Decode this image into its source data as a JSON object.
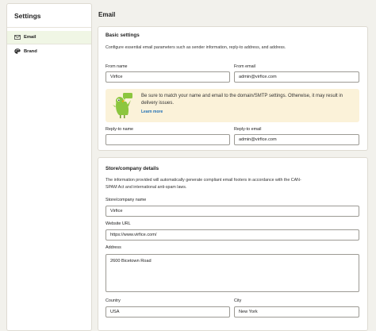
{
  "sidebar": {
    "title": "Settings",
    "items": [
      {
        "label": "Email",
        "icon": "mail-icon",
        "active": true
      },
      {
        "label": "Brand",
        "icon": "palette-icon",
        "active": false
      }
    ]
  },
  "page_title": "Email",
  "basic": {
    "title": "Basic settings",
    "description": "Configure essential email parameters such as sender information, reply-to address, and address.",
    "from_name_label": "From name",
    "from_name_value": "Virfice",
    "from_email_label": "From email",
    "from_email_value": "admin@virfice.com",
    "banner_text": "Be sure to match your name and email to the domain/SMTP settings. Otherwise, it may result in delivery issues.",
    "banner_link": "Learn more",
    "reply_to_name_label": "Reply-to name",
    "reply_to_name_value": "",
    "reply_to_email_label": "Reply-to email",
    "reply_to_email_value": "admin@virfice.com"
  },
  "company": {
    "title": "Store/company details",
    "description": "The information provided will automatically generate compliant email footers in accordance with the CAN-SPAM Act and international anti-spam laws.",
    "name_label": "Store/company name",
    "name_value": "Virfice",
    "website_label": "Website URL",
    "website_value": "https://www.virfice.com/",
    "address_label": "Address",
    "address_value": "2600 Bicetown Road",
    "country_label": "Country",
    "country_value": "USA",
    "city_label": "City",
    "city_value": "New York"
  },
  "colors": {
    "background": "#f2f1ec",
    "active_nav": "#f0f6e5",
    "banner": "#fbf2d9",
    "link": "#1f6fb5",
    "mascot": "#8cc63f"
  }
}
